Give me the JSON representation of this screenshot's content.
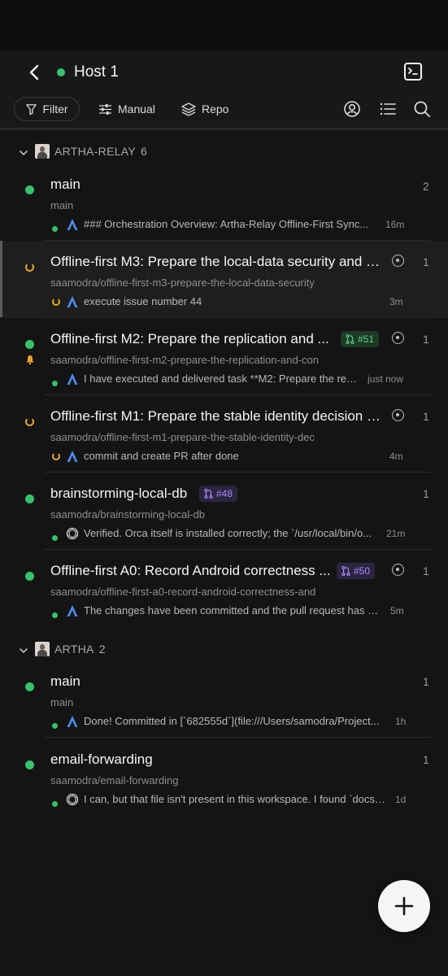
{
  "header": {
    "title": "Host 1",
    "status_color": "#34c36a"
  },
  "toolbar": {
    "filter_label": "Filter",
    "manual_label": "Manual",
    "repo_label": "Repo"
  },
  "groups": [
    {
      "name": "ARTHA-RELAY",
      "count": "6",
      "items": [
        {
          "title": "main",
          "subtitle": "main",
          "message": "### Orchestration Overview: Artha-Relay Offline-First Sync...",
          "time": "16m",
          "count": "2",
          "status": "active",
          "agent": "claude-icon"
        },
        {
          "title": "Offline-first M3: Prepare the local-data security and li...",
          "subtitle": "saamodra/offline-first-m3-prepare-the-local-data-security",
          "message": "execute issue number 44",
          "time": "3m",
          "count": "1",
          "status": "running",
          "agent": "claude-icon"
        },
        {
          "title": "Offline-first M2: Prepare the replication and ...",
          "subtitle": "saamodra/offline-first-m2-prepare-the-replication-and-con",
          "message": "I have executed and delivered task **M2: Prepare the repli...",
          "time": "just now",
          "count": "1",
          "status": "active",
          "pr": "#51",
          "agent": "claude-icon"
        },
        {
          "title": "Offline-first M1: Prepare the stable identity decision p...",
          "subtitle": "saamodra/offline-first-m1-prepare-the-stable-identity-dec",
          "message": "commit and create PR after done",
          "time": "4m",
          "count": "1",
          "status": "running",
          "agent": "claude-icon"
        },
        {
          "title": "brainstorming-local-db",
          "subtitle": "saamodra/brainstorming-local-db",
          "message": "Verified. Orca itself is installed correctly; the `/usr/local/bin/o...",
          "time": "21m",
          "count": "1",
          "status": "active",
          "pr": "#48",
          "agent": "openai-icon"
        },
        {
          "title": "Offline-first A0: Record Android correctness ...",
          "subtitle": "saamodra/offline-first-a0-record-android-correctness-and",
          "message": "The changes have been committed and the pull request has b...",
          "time": "5m",
          "count": "1",
          "status": "active",
          "pr": "#50",
          "agent": "claude-icon"
        }
      ]
    },
    {
      "name": "ARTHA",
      "count": "2",
      "items": [
        {
          "title": "main",
          "subtitle": "main",
          "message": "Done! Committed in [`682555d`](file:///Users/samodra/Project...",
          "time": "1h",
          "count": "1",
          "status": "active",
          "agent": "claude-icon"
        },
        {
          "title": "email-forwarding",
          "subtitle": "saamodra/email-forwarding",
          "message": "I can, but that file isn't present in this workspace. I found `docs/...",
          "time": "1d",
          "count": "1",
          "status": "active",
          "agent": "openai-icon"
        }
      ]
    }
  ],
  "colors": {
    "active": "#34c36a",
    "running": "#e6a52a",
    "pr_open": "#54d07f",
    "pr_draft": "#a78bfa",
    "agent_blue": "#4a8ef0"
  }
}
